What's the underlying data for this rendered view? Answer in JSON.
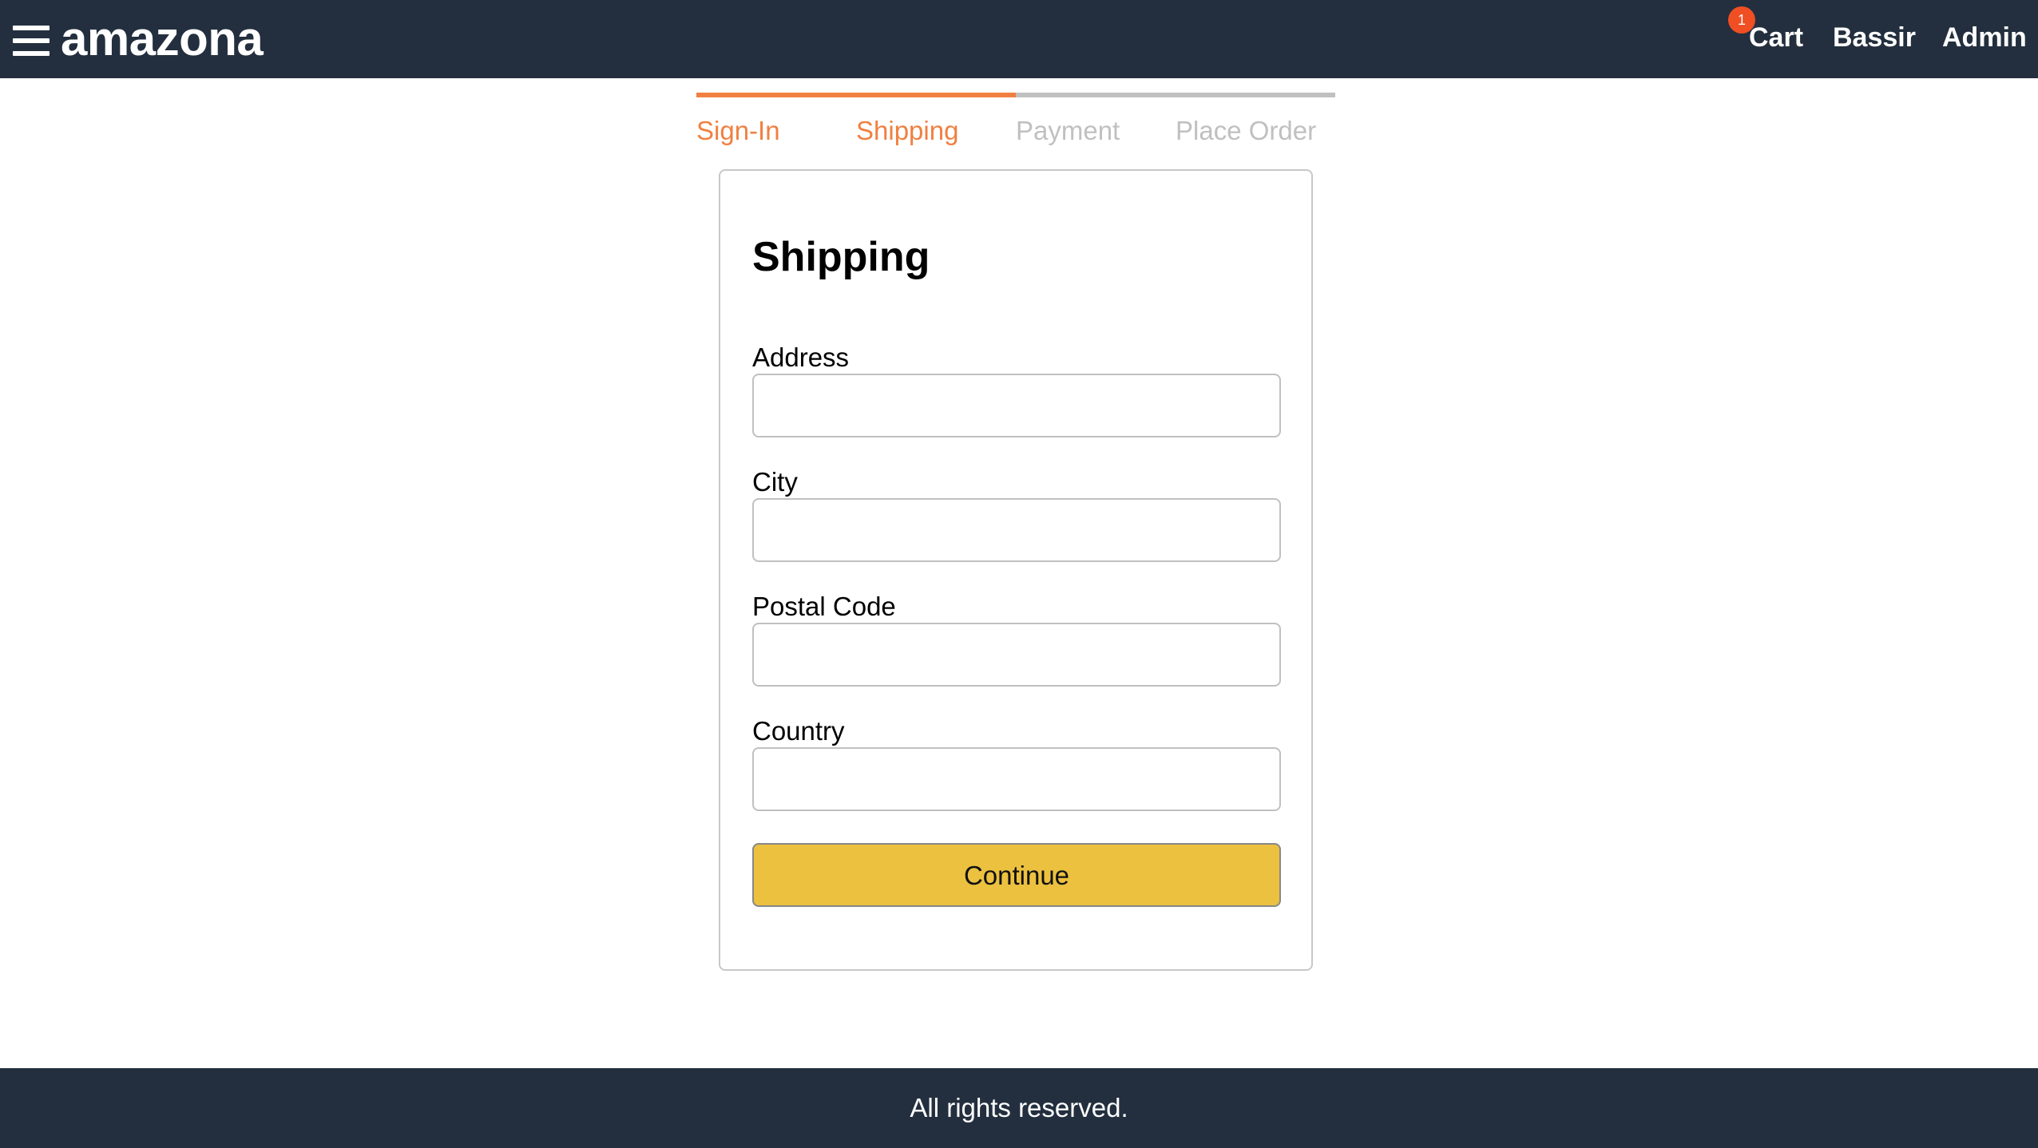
{
  "header": {
    "brand": "amazona",
    "menu_icon": "hamburger-menu-icon",
    "cart_label": "Cart",
    "cart_count": "1",
    "user_label": "Bassir",
    "admin_label": "Admin",
    "background_color": "#232f3e",
    "badge_color": "#f04e23"
  },
  "checkout_steps": {
    "active_color": "#f08040",
    "inactive_color": "#c0c0c0",
    "steps": [
      {
        "label": "Sign-In",
        "active": true
      },
      {
        "label": "Shipping",
        "active": true
      },
      {
        "label": "Payment",
        "active": false
      },
      {
        "label": "Place Order",
        "active": false
      }
    ]
  },
  "form": {
    "title": "Shipping",
    "fields": [
      {
        "label": "Address",
        "value": "",
        "placeholder": ""
      },
      {
        "label": "City",
        "value": "",
        "placeholder": ""
      },
      {
        "label": "Postal Code",
        "value": "",
        "placeholder": ""
      },
      {
        "label": "Country",
        "value": "",
        "placeholder": ""
      }
    ],
    "submit_label": "Continue",
    "submit_color": "#ebc13f"
  },
  "footer": {
    "text": "All rights reserved."
  }
}
